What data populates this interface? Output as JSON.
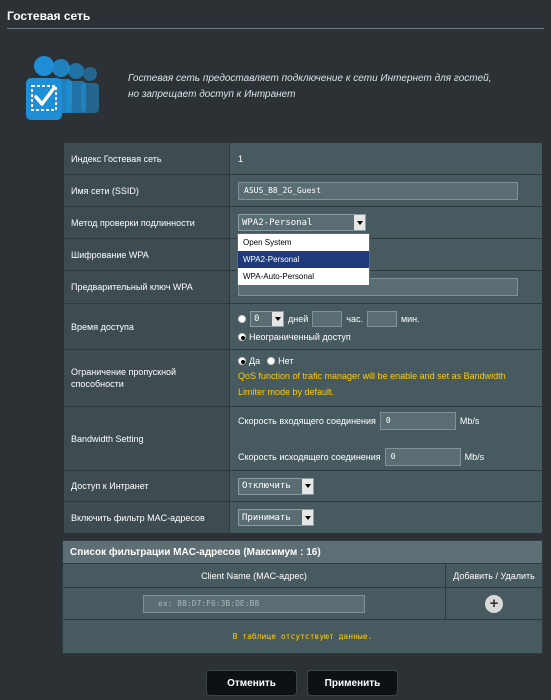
{
  "page": {
    "title": "Гостевая сеть",
    "intro_line1": "Гостевая сеть предоставляет подключение к сети Интернет для гостей,",
    "intro_line2": "но запрещает доступ к Интранет"
  },
  "settings": {
    "index": {
      "label": "Индекс Гостевая сеть",
      "value": "1"
    },
    "ssid": {
      "label": "Имя сети (SSID)",
      "value": "ASUS_B8_2G_Guest"
    },
    "auth_method": {
      "label": "Метод проверки подлинности",
      "selected": "WPA2-Personal",
      "options": [
        "Open System",
        "WPA2-Personal",
        "WPA-Auto-Personal"
      ]
    },
    "wpa_encryption": {
      "label": "Шифрование WPA"
    },
    "wpa_key": {
      "label": "Предварительный ключ WPA"
    },
    "access_time": {
      "label": "Время доступа",
      "days_value": "0",
      "days_unit": "дней",
      "hours_unit": "час.",
      "minutes_unit": "мин.",
      "unlimited_label": "Неограниченный доступ"
    },
    "bandwidth_limit": {
      "label": "Ограничение пропускной способности",
      "yes_label": "Да",
      "no_label": "Нет",
      "note_line1": "QoS function of trafic manager will be enable and set as Bandwidth",
      "note_line2": "Limiter mode by default."
    },
    "bandwidth_setting": {
      "label": "Bandwidth Setting",
      "downlink_label": "Скорость входящего соединения",
      "downlink_value": "0",
      "downlink_unit": "Mb/s",
      "uplink_label": "Скорость исходящего соединения",
      "uplink_value": "0",
      "uplink_unit": "Mb/s"
    },
    "intranet": {
      "label": "Доступ к Интранет",
      "selected": "Отключить"
    },
    "mac_filter": {
      "label": "Включить фильтр MAC-адресов",
      "selected": "Принимать"
    }
  },
  "mac_list": {
    "header": "Список фильтрации MAC-адресов (Максимум : 16)",
    "col_client": "Client Name (MAC-адрес)",
    "col_action": "Добавить / Удалить",
    "placeholder": "ex: 88:D7:F6:3B:DE:B8",
    "empty_text": "В таблице отсутствуют данные."
  },
  "buttons": {
    "cancel": "Отменить",
    "apply": "Применить"
  },
  "colors": {
    "accent_yellow": "#ffcc00",
    "icon_blue": "#1e8fd6",
    "background": "#2b3135"
  }
}
